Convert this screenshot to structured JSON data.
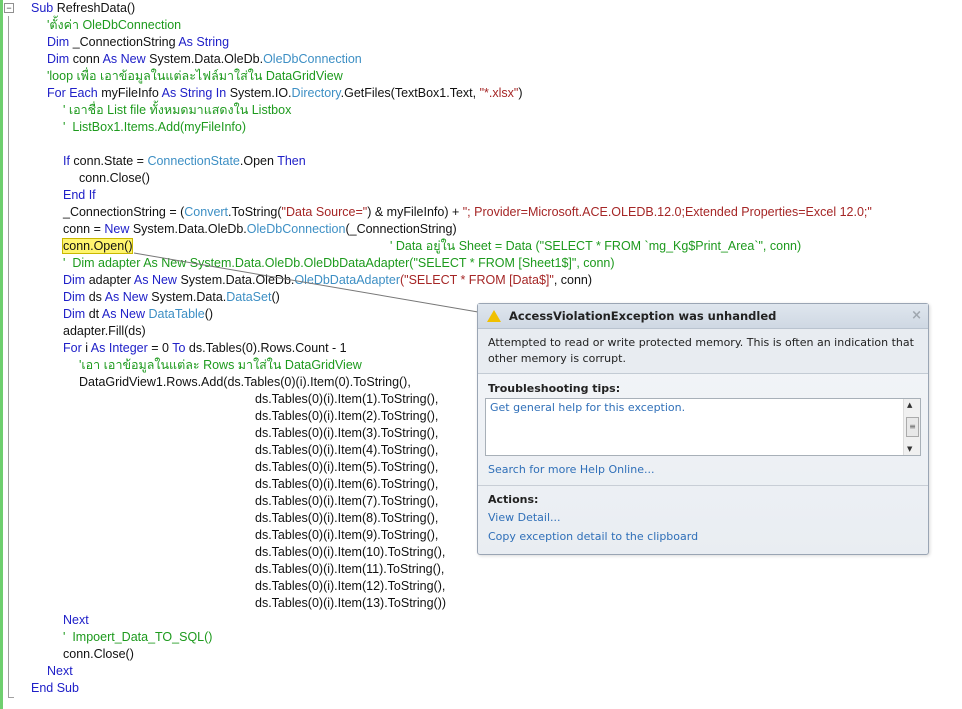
{
  "editor": {
    "lines": [
      {
        "d": 0,
        "t": [
          [
            "kw",
            "Sub "
          ],
          [
            "tx",
            "RefreshData()"
          ]
        ]
      },
      {
        "d": 1,
        "t": [
          [
            "cm",
            "'ตั้งค่า OleDbConnection"
          ]
        ]
      },
      {
        "d": 1,
        "t": [
          [
            "kw",
            "Dim "
          ],
          [
            "tx",
            "_ConnectionString "
          ],
          [
            "kw",
            "As String"
          ]
        ]
      },
      {
        "d": 1,
        "t": [
          [
            "kw",
            "Dim "
          ],
          [
            "tx",
            "conn "
          ],
          [
            "kw",
            "As New "
          ],
          [
            "tx",
            "System.Data.OleDb."
          ],
          [
            "ty",
            "OleDbConnection"
          ]
        ]
      },
      {
        "d": 1,
        "t": [
          [
            "cm",
            "'loop เพื่อ เอาข้อมูลในแต่ละไฟล์มาใส่ใน DataGridView"
          ]
        ]
      },
      {
        "d": 1,
        "t": [
          [
            "kw",
            "For Each "
          ],
          [
            "tx",
            "myFileInfo "
          ],
          [
            "kw",
            "As String In "
          ],
          [
            "tx",
            "System.IO."
          ],
          [
            "ty",
            "Directory"
          ],
          [
            "tx",
            ".GetFiles(TextBox1.Text, "
          ],
          [
            "st",
            "\"*.xlsx\""
          ],
          [
            "tx",
            ")"
          ]
        ]
      },
      {
        "d": 2,
        "t": [
          [
            "cm",
            "' เอาชื่อ List file ทั้งหมดมาแสดงใน Listbox"
          ]
        ]
      },
      {
        "d": 2,
        "t": [
          [
            "cm",
            "'  ListBox1.Items.Add(myFileInfo)"
          ]
        ]
      },
      {
        "d": 2,
        "t": []
      },
      {
        "d": 2,
        "t": [
          [
            "kw",
            "If "
          ],
          [
            "tx",
            "conn.State = "
          ],
          [
            "ty",
            "ConnectionState"
          ],
          [
            "tx",
            ".Open "
          ],
          [
            "kw",
            "Then"
          ]
        ]
      },
      {
        "d": 3,
        "t": [
          [
            "tx",
            "conn.Close()"
          ]
        ]
      },
      {
        "d": 2,
        "t": [
          [
            "kw",
            "End If"
          ]
        ]
      },
      {
        "d": 2,
        "t": [
          [
            "tx",
            "_ConnectionString = ("
          ],
          [
            "ty",
            "Convert"
          ],
          [
            "tx",
            ".ToString("
          ],
          [
            "st",
            "\"Data Source=\""
          ],
          [
            "tx",
            ") & myFileInfo) + "
          ],
          [
            "st",
            "\"; Provider=Microsoft.ACE.OLEDB.12.0;Extended Properties=Excel 12.0;\""
          ]
        ]
      },
      {
        "d": 2,
        "t": [
          [
            "tx",
            "conn = "
          ],
          [
            "kw",
            "New "
          ],
          [
            "tx",
            "System.Data.OleDb."
          ],
          [
            "ty",
            "OleDbConnection"
          ],
          [
            "tx",
            "(_ConnectionString)"
          ]
        ]
      },
      {
        "d": 2,
        "t": [
          [
            "hl",
            "conn.Open()"
          ]
        ],
        "trail": "' Data อยู่ใน Sheet = Data (\"SELECT * FROM `mg_Kg$Print_Area`\", conn)"
      },
      {
        "d": 2,
        "t": [
          [
            "cm",
            "'  Dim adapter As New System.Data.OleDb.OleDbDataAdapter(\"SELECT * FROM [Sheet1$]\", conn)"
          ]
        ]
      },
      {
        "d": 2,
        "t": [
          [
            "kw",
            "Dim "
          ],
          [
            "tx",
            "adapter "
          ],
          [
            "kw",
            "As New "
          ],
          [
            "tx",
            "System.Data.OleDb."
          ],
          [
            "ty",
            "OleDbDataAdapter"
          ],
          [
            "st",
            "(\"SELECT * FROM [Data$]\""
          ],
          [
            "tx",
            ", conn)"
          ]
        ]
      },
      {
        "d": 2,
        "t": [
          [
            "kw",
            "Dim "
          ],
          [
            "tx",
            "ds "
          ],
          [
            "kw",
            "As New "
          ],
          [
            "tx",
            "System.Data."
          ],
          [
            "ty",
            "DataSet"
          ],
          [
            "tx",
            "()"
          ]
        ]
      },
      {
        "d": 2,
        "t": [
          [
            "kw",
            "Dim "
          ],
          [
            "tx",
            "dt "
          ],
          [
            "kw",
            "As New "
          ],
          [
            "ty",
            "DataTable"
          ],
          [
            "tx",
            "()"
          ]
        ]
      },
      {
        "d": 2,
        "t": [
          [
            "tx",
            "adapter.Fill(ds)"
          ]
        ]
      },
      {
        "d": 2,
        "t": [
          [
            "kw",
            "For "
          ],
          [
            "tx",
            "i "
          ],
          [
            "kw",
            "As Integer "
          ],
          [
            "tx",
            "= 0 "
          ],
          [
            "kw",
            "To "
          ],
          [
            "tx",
            "ds.Tables(0).Rows.Count - 1"
          ]
        ]
      },
      {
        "d": 3,
        "t": [
          [
            "cm",
            "'เอา เอาข้อมูลในแต่ละ Rows มาใส่ใน DataGridView"
          ]
        ]
      },
      {
        "d": 3,
        "t": [
          [
            "tx",
            "DataGridView1.Rows.Add(ds.Tables(0)(i).Item(0).ToString(),"
          ]
        ]
      },
      {
        "d": 14,
        "t": [
          [
            "tx",
            "ds.Tables(0)(i).Item(1).ToString(),"
          ]
        ]
      },
      {
        "d": 14,
        "t": [
          [
            "tx",
            "ds.Tables(0)(i).Item(2).ToString(),"
          ]
        ]
      },
      {
        "d": 14,
        "t": [
          [
            "tx",
            "ds.Tables(0)(i).Item(3).ToString(),"
          ]
        ]
      },
      {
        "d": 14,
        "t": [
          [
            "tx",
            "ds.Tables(0)(i).Item(4).ToString(),"
          ]
        ]
      },
      {
        "d": 14,
        "t": [
          [
            "tx",
            "ds.Tables(0)(i).Item(5).ToString(),"
          ]
        ]
      },
      {
        "d": 14,
        "t": [
          [
            "tx",
            "ds.Tables(0)(i).Item(6).ToString(),"
          ]
        ]
      },
      {
        "d": 14,
        "t": [
          [
            "tx",
            "ds.Tables(0)(i).Item(7).ToString(),"
          ]
        ]
      },
      {
        "d": 14,
        "t": [
          [
            "tx",
            "ds.Tables(0)(i).Item(8).ToString(),"
          ]
        ]
      },
      {
        "d": 14,
        "t": [
          [
            "tx",
            "ds.Tables(0)(i).Item(9).ToString(),"
          ]
        ]
      },
      {
        "d": 14,
        "t": [
          [
            "tx",
            "ds.Tables(0)(i).Item(10).ToString(),"
          ]
        ]
      },
      {
        "d": 14,
        "t": [
          [
            "tx",
            "ds.Tables(0)(i).Item(11).ToString(),"
          ]
        ]
      },
      {
        "d": 14,
        "t": [
          [
            "tx",
            "ds.Tables(0)(i).Item(12).ToString(),"
          ]
        ]
      },
      {
        "d": 14,
        "t": [
          [
            "tx",
            "ds.Tables(0)(i).Item(13).ToString())"
          ]
        ]
      },
      {
        "d": 2,
        "t": [
          [
            "kw",
            "Next"
          ]
        ]
      },
      {
        "d": 2,
        "t": [
          [
            "cm",
            "'  Impoert_Data_TO_SQL()"
          ]
        ]
      },
      {
        "d": 2,
        "t": [
          [
            "tx",
            "conn.Close()"
          ]
        ]
      },
      {
        "d": 1,
        "t": [
          [
            "kw",
            "Next"
          ]
        ]
      },
      {
        "d": 0,
        "t": [
          [
            "kw",
            "End Sub"
          ]
        ]
      }
    ]
  },
  "dialog": {
    "title": "AccessViolationException was unhandled",
    "close": "×",
    "message": "Attempted to read or write protected memory. This is often an indication that other memory is corrupt.",
    "tips_heading": "Troubleshooting tips:",
    "tip_link": "Get general help for this exception.",
    "search_link": "Search for more Help Online...",
    "actions_heading": "Actions:",
    "actions": [
      "View Detail...",
      "Copy exception detail to the clipboard"
    ]
  },
  "colors": {
    "keyword": "#1f20c8",
    "type": "#3d8fc4",
    "comment": "#1d9a1d",
    "string": "#a52626"
  }
}
